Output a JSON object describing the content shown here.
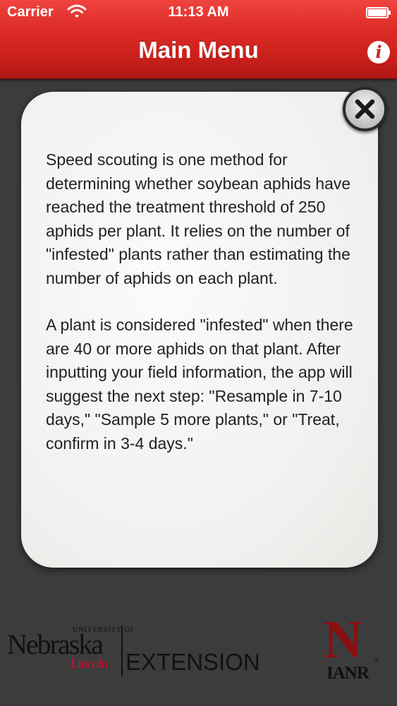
{
  "status_bar": {
    "carrier": "Carrier",
    "time": "11:13 AM",
    "battery_level": 1.0
  },
  "nav": {
    "title": "Main Menu",
    "info_label": "i"
  },
  "dialog": {
    "paragraphs": [
      "Speed scouting is one method for determining whether soybean aphids have reached the treatment threshold of 250 aphids per plant. It relies on the number of \"infested\" plants rather than estimating the number of aphids on each plant.",
      "A plant is considered \"infested\" when there are 40 or more aphids on that plant. After inputting your field information, the app will suggest the next step: \"Resample in 7-10 days,\" \"Sample 5 more plants,\" or \"Treat, confirm in 3-4 days.\""
    ],
    "close_icon": "close-icon"
  },
  "footer": {
    "unl": {
      "small": "UNIVERSITY OF",
      "name": "Nebraska",
      "campus": "Lincoln",
      "unit": "EXTENSION"
    },
    "ianr": {
      "letter": "N",
      "text": "IANR",
      "reg": "®"
    }
  },
  "colors": {
    "nav_red": "#d8231f",
    "background": "#3c3c3c",
    "card": "#f1f0ee",
    "nebraska_red": "#c8102e",
    "ianr_red": "#8b0f12"
  }
}
